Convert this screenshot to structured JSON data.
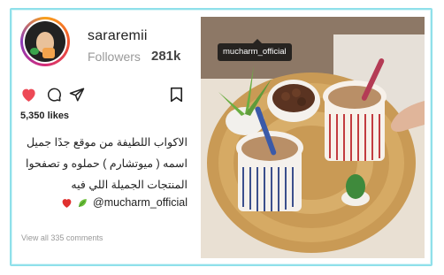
{
  "profile": {
    "username": "sararemii",
    "followers_label": "Followers",
    "followers_count": "281k"
  },
  "icons": {
    "like": "heart-icon",
    "comment": "comment-icon",
    "share": "share-icon",
    "save": "bookmark-icon"
  },
  "post": {
    "likes": "5,350 likes",
    "caption_lines": [
      "الاكواب اللطيفة من موقع جدًا جميل",
      "اسمه ( ميوتشارم ) حملوه و تصفحوا",
      "المنتجات الجميلة اللي فيه"
    ],
    "mention": "@mucharm_official",
    "view_comments": "View all 335 comments",
    "photo_tag": "mucharm_official"
  },
  "colors": {
    "like_red": "#ed4956",
    "frame_border": "#8fe0ea",
    "muted_text": "#9a9a9a"
  }
}
